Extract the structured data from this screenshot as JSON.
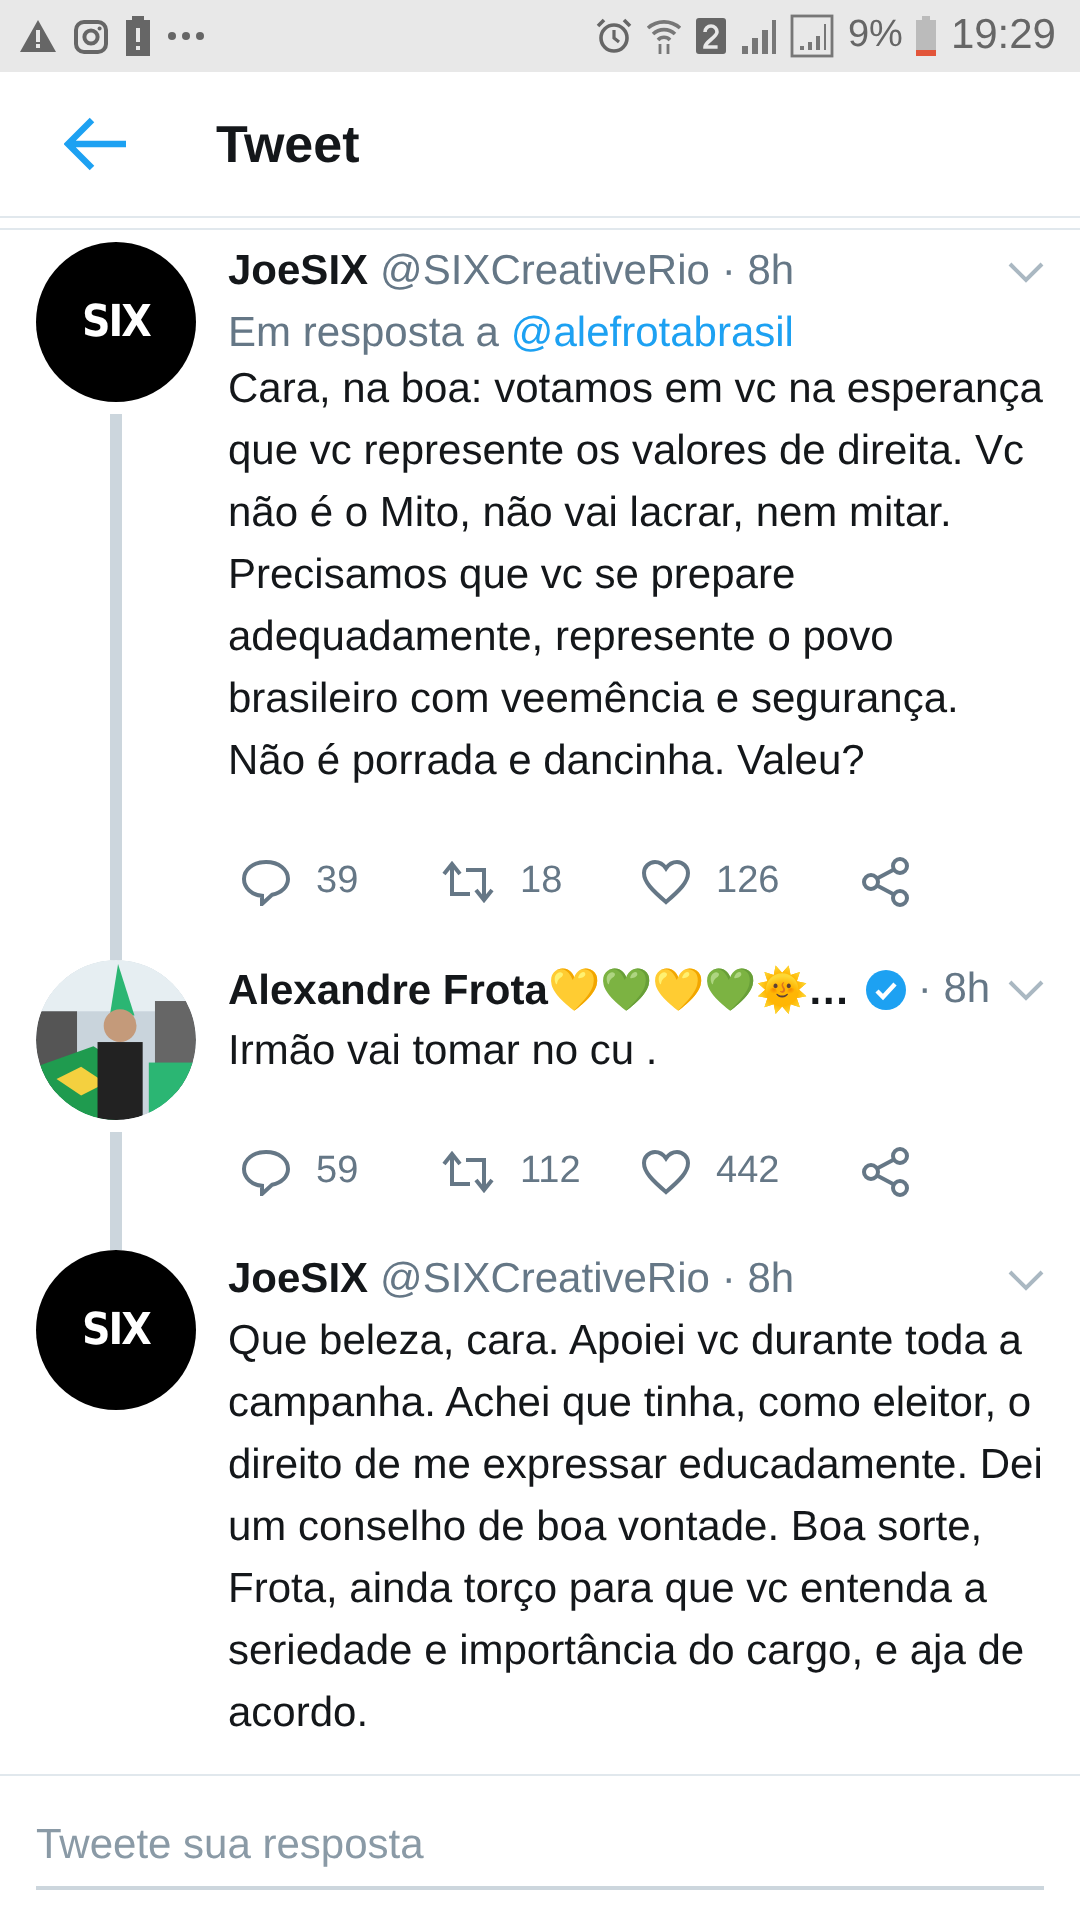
{
  "status_bar": {
    "battery": "9%",
    "time": "19:29"
  },
  "header": {
    "title": "Tweet"
  },
  "tweets": [
    {
      "avatar": {
        "kind": "logo",
        "text": "SIX"
      },
      "name": "JoeSIX",
      "handle": "@SIXCreativeRio",
      "time": "· 8h",
      "verified": false,
      "reply_to": {
        "label": "Em resposta a",
        "handle": "@alefrotabrasil"
      },
      "text": "Cara, na boa: votamos em vc na esperança que vc represente os valores de direita. Vc não é o Mito, não vai lacrar, nem mitar. Precisamos que vc se prepare adequadamente, represente o povo brasileiro com veemência e segurança. Não é porrada e dancinha. Valeu?",
      "replies": "39",
      "retweets": "18",
      "likes": "126"
    },
    {
      "name": "Alexandre Frota💛💚💛💚🌞…",
      "time": "· 8h",
      "verified": true,
      "text": "Irmão vai tomar no cu .",
      "replies": "59",
      "retweets": "112",
      "likes": "442"
    },
    {
      "avatar": {
        "kind": "logo",
        "text": "SIX"
      },
      "name": "JoeSIX",
      "handle": "@SIXCreativeRio",
      "time": "· 8h",
      "verified": false,
      "text": "Que beleza, cara. Apoiei vc durante toda a campanha. Achei que tinha, como eleitor, o direito de me expressar educadamente. Dei um conselho de boa vontade. Boa sorte, Frota, ainda torço para que vc entenda a seriedade e importância do cargo, e aja de acordo."
    }
  ],
  "reply_bar": {
    "placeholder": "Tweete sua resposta"
  }
}
